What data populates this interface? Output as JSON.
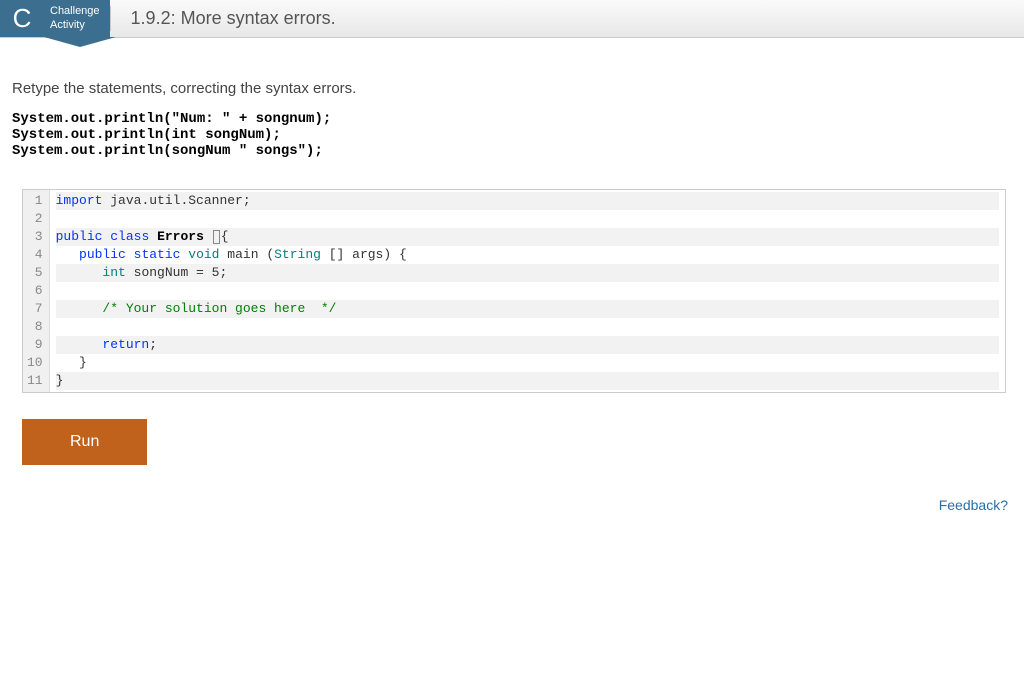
{
  "header": {
    "badge_letter": "C",
    "badge_line1": "Challenge",
    "badge_line2": "Activity",
    "title": "1.9.2: More syntax errors."
  },
  "instructions": "Retype the statements, correcting the syntax errors.",
  "problem_lines": [
    "System.out.println(\"Num: \" + songnum);",
    "System.out.println(int songNum);",
    "System.out.println(songNum \" songs\");"
  ],
  "editor": {
    "line_numbers": [
      "1",
      "2",
      "3",
      "4",
      "5",
      "6",
      "7",
      "8",
      "9",
      "10",
      "11"
    ]
  },
  "buttons": {
    "run_label": "Run"
  },
  "footer": {
    "feedback": "Feedback?"
  }
}
